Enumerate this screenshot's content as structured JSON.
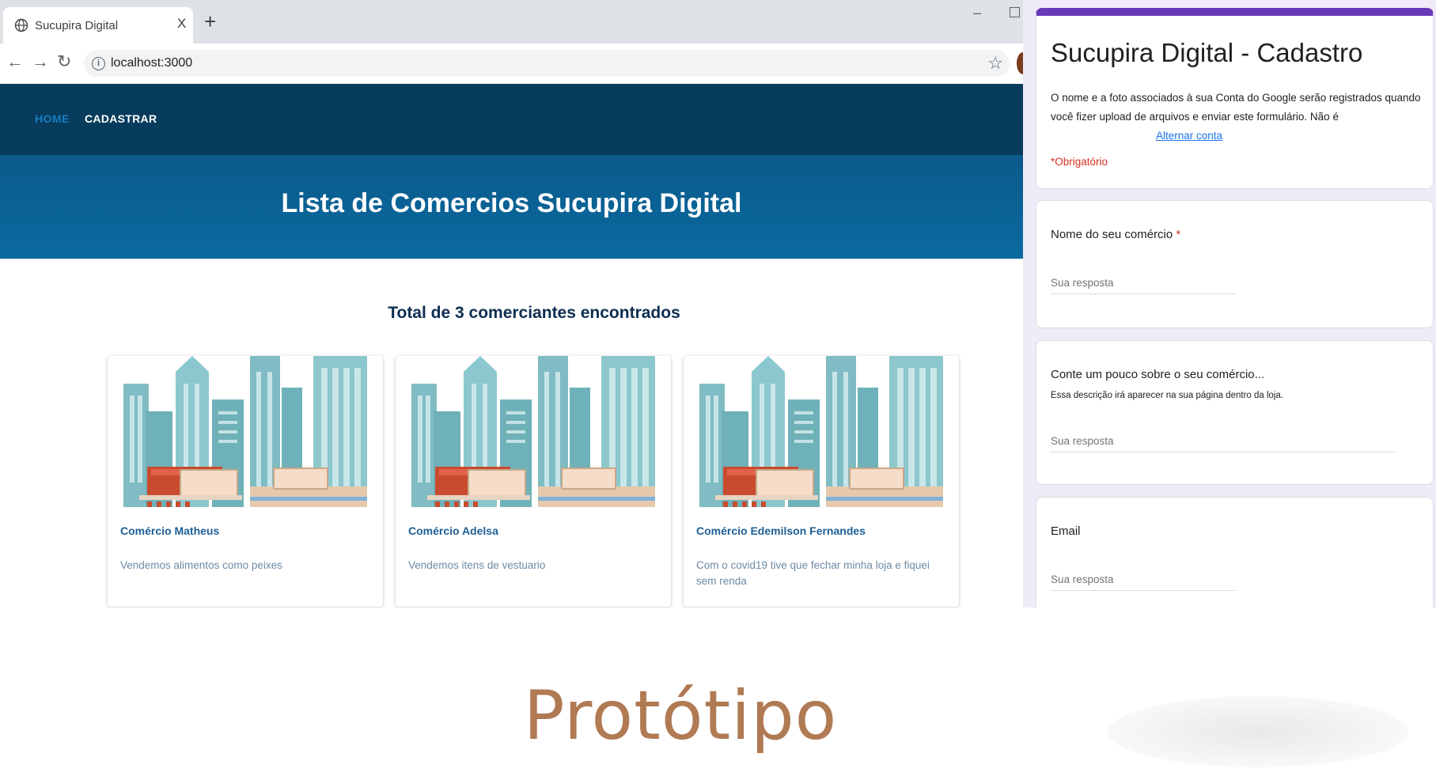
{
  "browser": {
    "tab_title": "Sucupira Digital",
    "tab_close": "X",
    "new_tab": "+",
    "url": "localhost:3000",
    "minimize": "–"
  },
  "site": {
    "nav": {
      "home": "HOME",
      "cadastrar": "CADASTRAR"
    },
    "hero_title": "Lista de Comercios Sucupira Digital",
    "total_text": "Total de 3 comerciantes encontrados",
    "cards": [
      {
        "title": "Comércio Matheus",
        "description": "Vendemos alimentos como peixes"
      },
      {
        "title": "Comércio Adelsa",
        "description": "Vendemos itens de vestuario"
      },
      {
        "title": "Comércio Edemilson Fernandes",
        "description": "Com o covid19 tive que fechar minha loja e fiquei sem renda"
      }
    ]
  },
  "form": {
    "title": "Sucupira Digital - Cadastro",
    "notice": "O nome e a foto associados à sua Conta do Google serão registrados quando você fizer upload de arquivos e enviar este formulário. Não é",
    "switch_account": "Alternar conta",
    "required_note": "*Obrigatório",
    "questions": [
      {
        "label": "Nome do seu comércio",
        "required_mark": "*",
        "placeholder": "Sua resposta"
      },
      {
        "label": "Conte um pouco sobre o seu comércio...",
        "help": "Essa descrição irá aparecer na sua página dentro da loja.",
        "placeholder": "Sua resposta"
      },
      {
        "label": "Email",
        "placeholder": "Sua resposta"
      }
    ]
  },
  "caption": "Protótipo",
  "colors": {
    "nav_bg": "#073c5c",
    "hero_bg": "#0a6aa0",
    "form_accent": "#673ab7",
    "caption": "#b07a53"
  }
}
